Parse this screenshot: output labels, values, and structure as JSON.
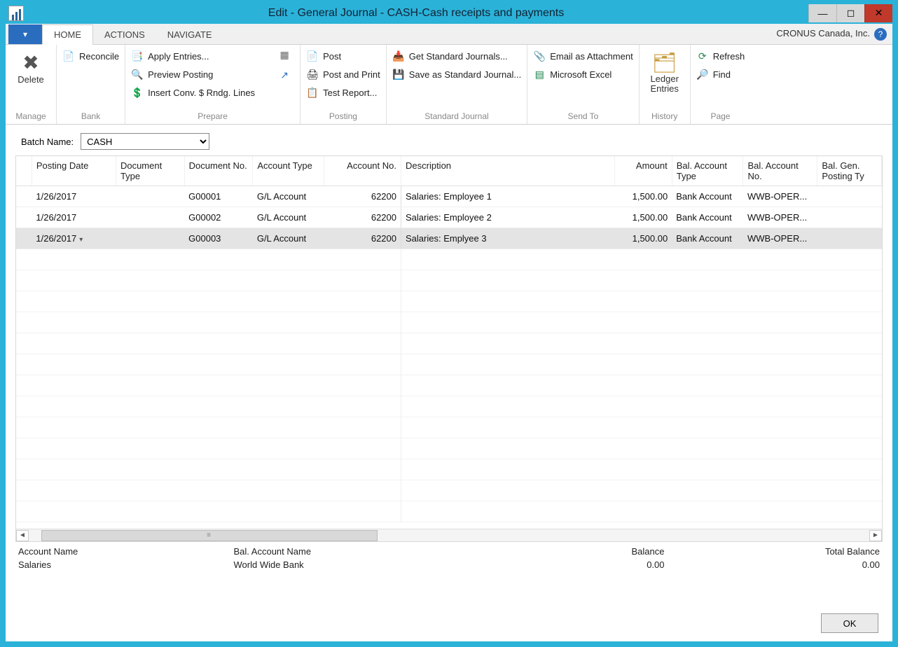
{
  "window": {
    "title": "Edit - General Journal - CASH-Cash receipts and payments"
  },
  "win_btns": {
    "min": "—",
    "max": "◻",
    "close": "✕"
  },
  "company": "CRONUS Canada, Inc.",
  "tabs": {
    "file": "▾",
    "home": "HOME",
    "actions": "ACTIONS",
    "navigate": "NAVIGATE"
  },
  "ribbon": {
    "manage": {
      "label": "Manage",
      "delete": "Delete"
    },
    "bank": {
      "label": "Bank",
      "reconcile": "Reconcile"
    },
    "prepare": {
      "label": "Prepare",
      "apply": "Apply Entries...",
      "preview": "Preview Posting",
      "insert": "Insert Conv. $ Rndg. Lines"
    },
    "posting": {
      "label": "Posting",
      "post": "Post",
      "postprint": "Post and Print",
      "testreport": "Test Report..."
    },
    "standard": {
      "label": "Standard Journal",
      "get": "Get Standard Journals...",
      "save": "Save as Standard Journal..."
    },
    "sendto": {
      "label": "Send To",
      "email": "Email as Attachment",
      "excel": "Microsoft Excel"
    },
    "history": {
      "label": "History",
      "ledger": "Ledger Entries"
    },
    "page": {
      "label": "Page",
      "refresh": "Refresh",
      "find": "Find"
    }
  },
  "batch": {
    "label": "Batch Name:",
    "value": "CASH"
  },
  "columns": {
    "posting_date": "Posting Date",
    "doc_type": "Document Type",
    "doc_no": "Document No.",
    "acct_type": "Account Type",
    "acct_no": "Account No.",
    "description": "Description",
    "amount": "Amount",
    "bal_type": "Bal. Account Type",
    "bal_no": "Bal. Account No.",
    "bal_gen": "Bal. Gen. Posting Ty"
  },
  "rows": [
    {
      "date": "1/26/2017",
      "dtype": "",
      "dno": "G00001",
      "atype": "G/L Account",
      "ano": "62200",
      "desc": "Salaries: Employee 1",
      "amt": "1,500.00",
      "btype": "Bank Account",
      "bno": "WWB-OPER..."
    },
    {
      "date": "1/26/2017",
      "dtype": "",
      "dno": "G00002",
      "atype": "G/L Account",
      "ano": "62200",
      "desc": "Salaries: Employee 2",
      "amt": "1,500.00",
      "btype": "Bank Account",
      "bno": "WWB-OPER..."
    },
    {
      "date": "1/26/2017",
      "dtype": "",
      "dno": "G00003",
      "atype": "G/L Account",
      "ano": "62200",
      "desc": "Salaries: Emplyee 3",
      "amt": "1,500.00",
      "btype": "Bank Account",
      "bno": "WWB-OPER..."
    }
  ],
  "footer": {
    "acct_name_lbl": "Account Name",
    "acct_name_val": "Salaries",
    "bal_name_lbl": "Bal. Account Name",
    "bal_name_val": "World Wide Bank",
    "balance_lbl": "Balance",
    "balance_val": "0.00",
    "total_lbl": "Total Balance",
    "total_val": "0.00"
  },
  "ok": "OK"
}
